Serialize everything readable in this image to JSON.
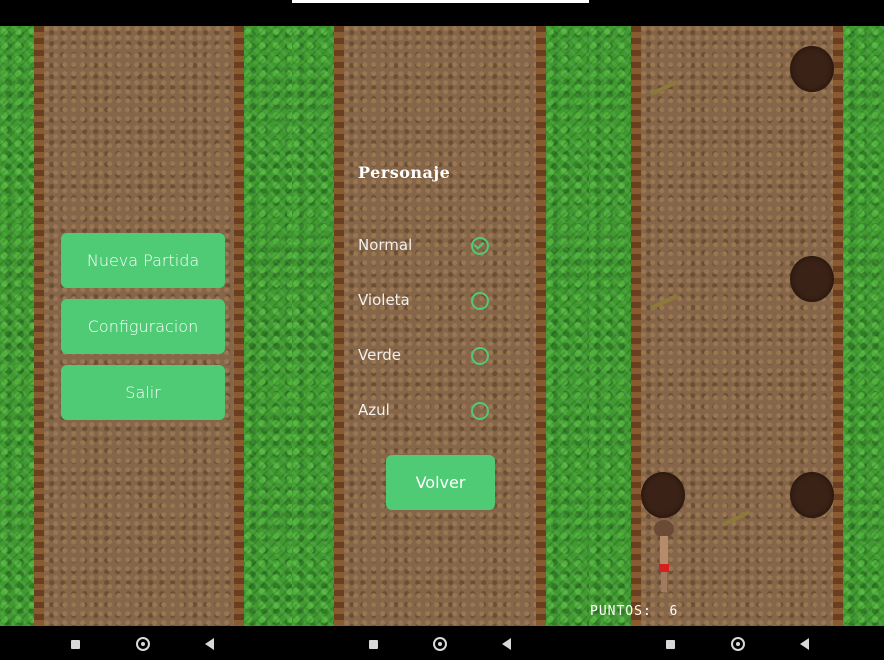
{
  "main_menu": {
    "buttons": [
      "Nueva Partida",
      "Configuracion",
      "Salir"
    ]
  },
  "config": {
    "title": "Personaje",
    "options": [
      {
        "label": "Normal",
        "selected": true
      },
      {
        "label": "Violeta",
        "selected": false
      },
      {
        "label": "Verde",
        "selected": false
      },
      {
        "label": "Azul",
        "selected": false
      }
    ],
    "back_label": "Volver"
  },
  "game": {
    "score_label": "PUNTOS:",
    "score_value": "6"
  },
  "colors": {
    "button": "#4ecb74",
    "grass": "#3f9b2f",
    "path": "#85664a",
    "hole": "#3a2216"
  },
  "nav_icons": [
    "recents-square-icon",
    "home-circle-icon",
    "back-triangle-icon"
  ]
}
